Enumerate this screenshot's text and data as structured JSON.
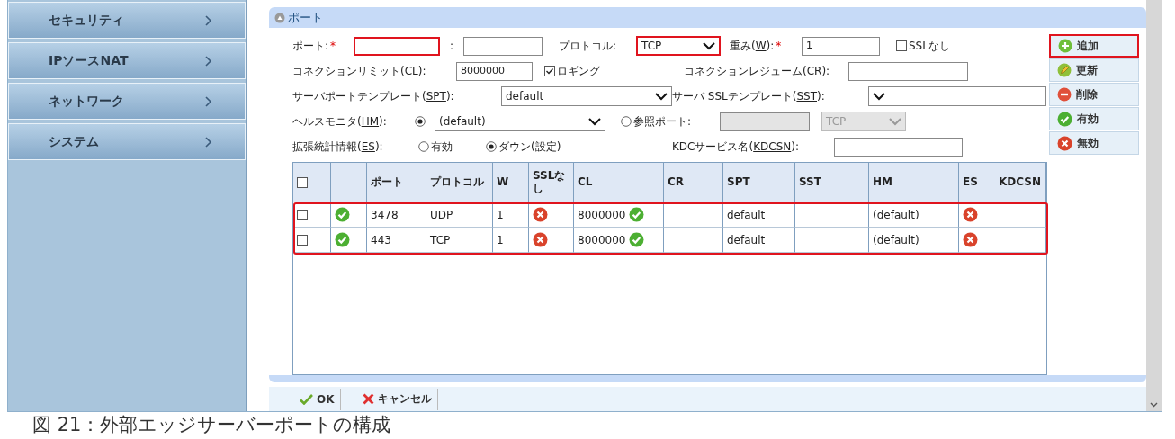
{
  "sidebar": {
    "items": [
      {
        "label": "セキュリティ"
      },
      {
        "label": "IPソースNAT"
      },
      {
        "label": "ネットワーク"
      },
      {
        "label": "システム"
      }
    ]
  },
  "panel": {
    "title": "ポート",
    "collapsed": false
  },
  "form": {
    "port": {
      "label": "ポート:",
      "required_mark": "*",
      "highlighted": true
    },
    "port_sep": ":",
    "protocol": {
      "label": "プロトコル:",
      "value": "TCP",
      "highlighted": true
    },
    "weight": {
      "label": {
        "before": "重み(",
        "key": "W",
        "after": "):"
      },
      "required_mark": "*",
      "value": "1"
    },
    "ssl_off": {
      "label": "SSLなし",
      "checked": false
    },
    "conn_limit": {
      "label": {
        "before": "コネクションリミット(",
        "key": "CL",
        "after": "):"
      },
      "value": "8000000"
    },
    "logging": {
      "label": "ロギング",
      "checked": true
    },
    "conn_resume": {
      "label": {
        "before": "コネクションレジューム(",
        "key": "CR",
        "after": "):"
      }
    },
    "spt": {
      "label": {
        "before": "サーバポートテンプレート(",
        "key": "SPT",
        "after": "):"
      },
      "value": "default"
    },
    "sst": {
      "label": {
        "before": "サーバ SSLテンプレート(",
        "key": "SST",
        "after": "):"
      }
    },
    "hm": {
      "label": {
        "before": "ヘルスモニタ(",
        "key": "HM",
        "after": "):"
      },
      "selected": true,
      "value": "(default)"
    },
    "ref_port": {
      "label": "参照ポート:",
      "selected": false,
      "protocol": "TCP",
      "disabled": true
    },
    "es": {
      "label": {
        "before": "拡張統計情報(",
        "key": "ES",
        "after": "):"
      },
      "options": [
        {
          "label": "有効",
          "selected": false
        },
        {
          "label": "ダウン(設定)",
          "selected": true
        }
      ]
    },
    "kdcsn": {
      "label": {
        "before": "KDCサービス名(",
        "key": "KDCSN",
        "after": "):"
      }
    }
  },
  "actions": [
    {
      "kind": "add",
      "label": "追加",
      "highlighted": true
    },
    {
      "kind": "update",
      "label": "更新",
      "highlighted": false
    },
    {
      "kind": "delete",
      "label": "削除",
      "highlighted": false
    },
    {
      "kind": "enable",
      "label": "有効",
      "highlighted": false
    },
    {
      "kind": "disable",
      "label": "無効",
      "highlighted": false
    }
  ],
  "table": {
    "columns": [
      "",
      "",
      "ポート",
      "プロトコル",
      "W",
      "SSLなし",
      "CL",
      "CR",
      "SPT",
      "SST",
      "HM",
      "ES",
      "KDCSN"
    ],
    "rows_highlighted": true,
    "select_all_checked": false,
    "rows": [
      {
        "checked": false,
        "enabled": true,
        "port": "3478",
        "protocol": "UDP",
        "weight": "1",
        "ssl_off": false,
        "cl": "8000000",
        "cl_on": true,
        "spt": "default",
        "hm": "(default)",
        "es": false
      },
      {
        "checked": false,
        "enabled": true,
        "port": "443",
        "protocol": "TCP",
        "weight": "1",
        "ssl_off": false,
        "cl": "8000000",
        "cl_on": true,
        "spt": "default",
        "hm": "(default)",
        "es": false
      }
    ]
  },
  "footer": {
    "ok": "OK",
    "cancel": "キャンセル"
  },
  "caption": "図 21：外部エッジサーバーポートの構成"
}
